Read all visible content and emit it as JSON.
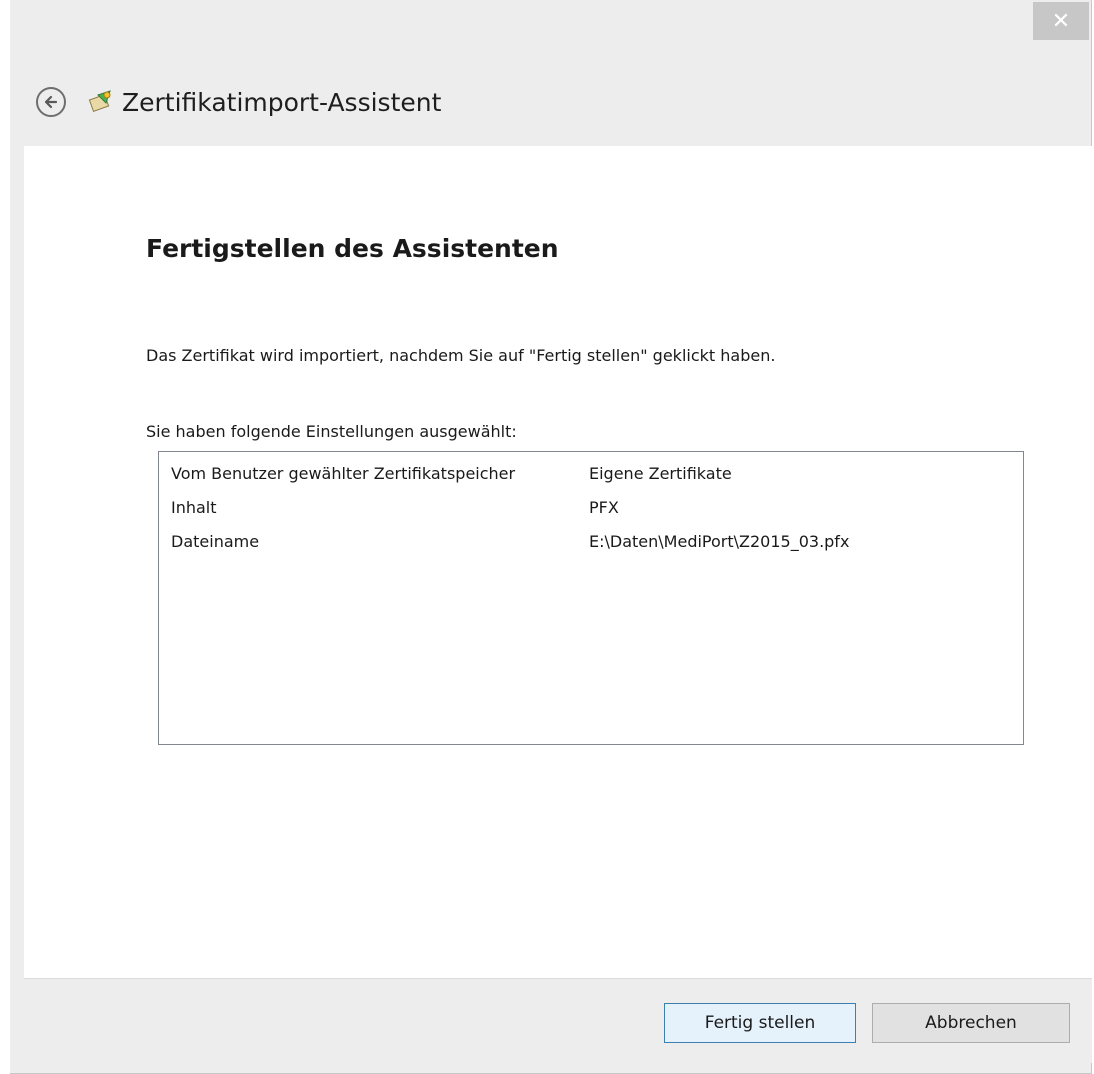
{
  "window": {
    "close_glyph": "✕",
    "title": "Zertifikatimport-Assistent"
  },
  "page": {
    "heading": "Fertigstellen des Assistenten",
    "intro": "Das Zertifikat wird importiert, nachdem Sie auf \"Fertig stellen\" geklickt haben.",
    "settings_label": "Sie haben folgende Einstellungen ausgewählt:",
    "settings": [
      {
        "key": "Vom Benutzer gewählter Zertifikatspeicher",
        "value": "Eigene Zertifikate"
      },
      {
        "key": "Inhalt",
        "value": "PFX"
      },
      {
        "key": "Dateiname",
        "value": "E:\\Daten\\MediPort\\Z2015_03.pfx"
      }
    ]
  },
  "buttons": {
    "finish": "Fertig stellen",
    "cancel": "Abbrechen"
  },
  "icons": {
    "back": "back-arrow-icon",
    "certificate": "certificate-icon",
    "close": "close-icon"
  },
  "colors": {
    "chrome": "#ededed",
    "content": "#ffffff",
    "close_button": "#c7c7c7",
    "default_button_border": "#3c7fb1"
  }
}
